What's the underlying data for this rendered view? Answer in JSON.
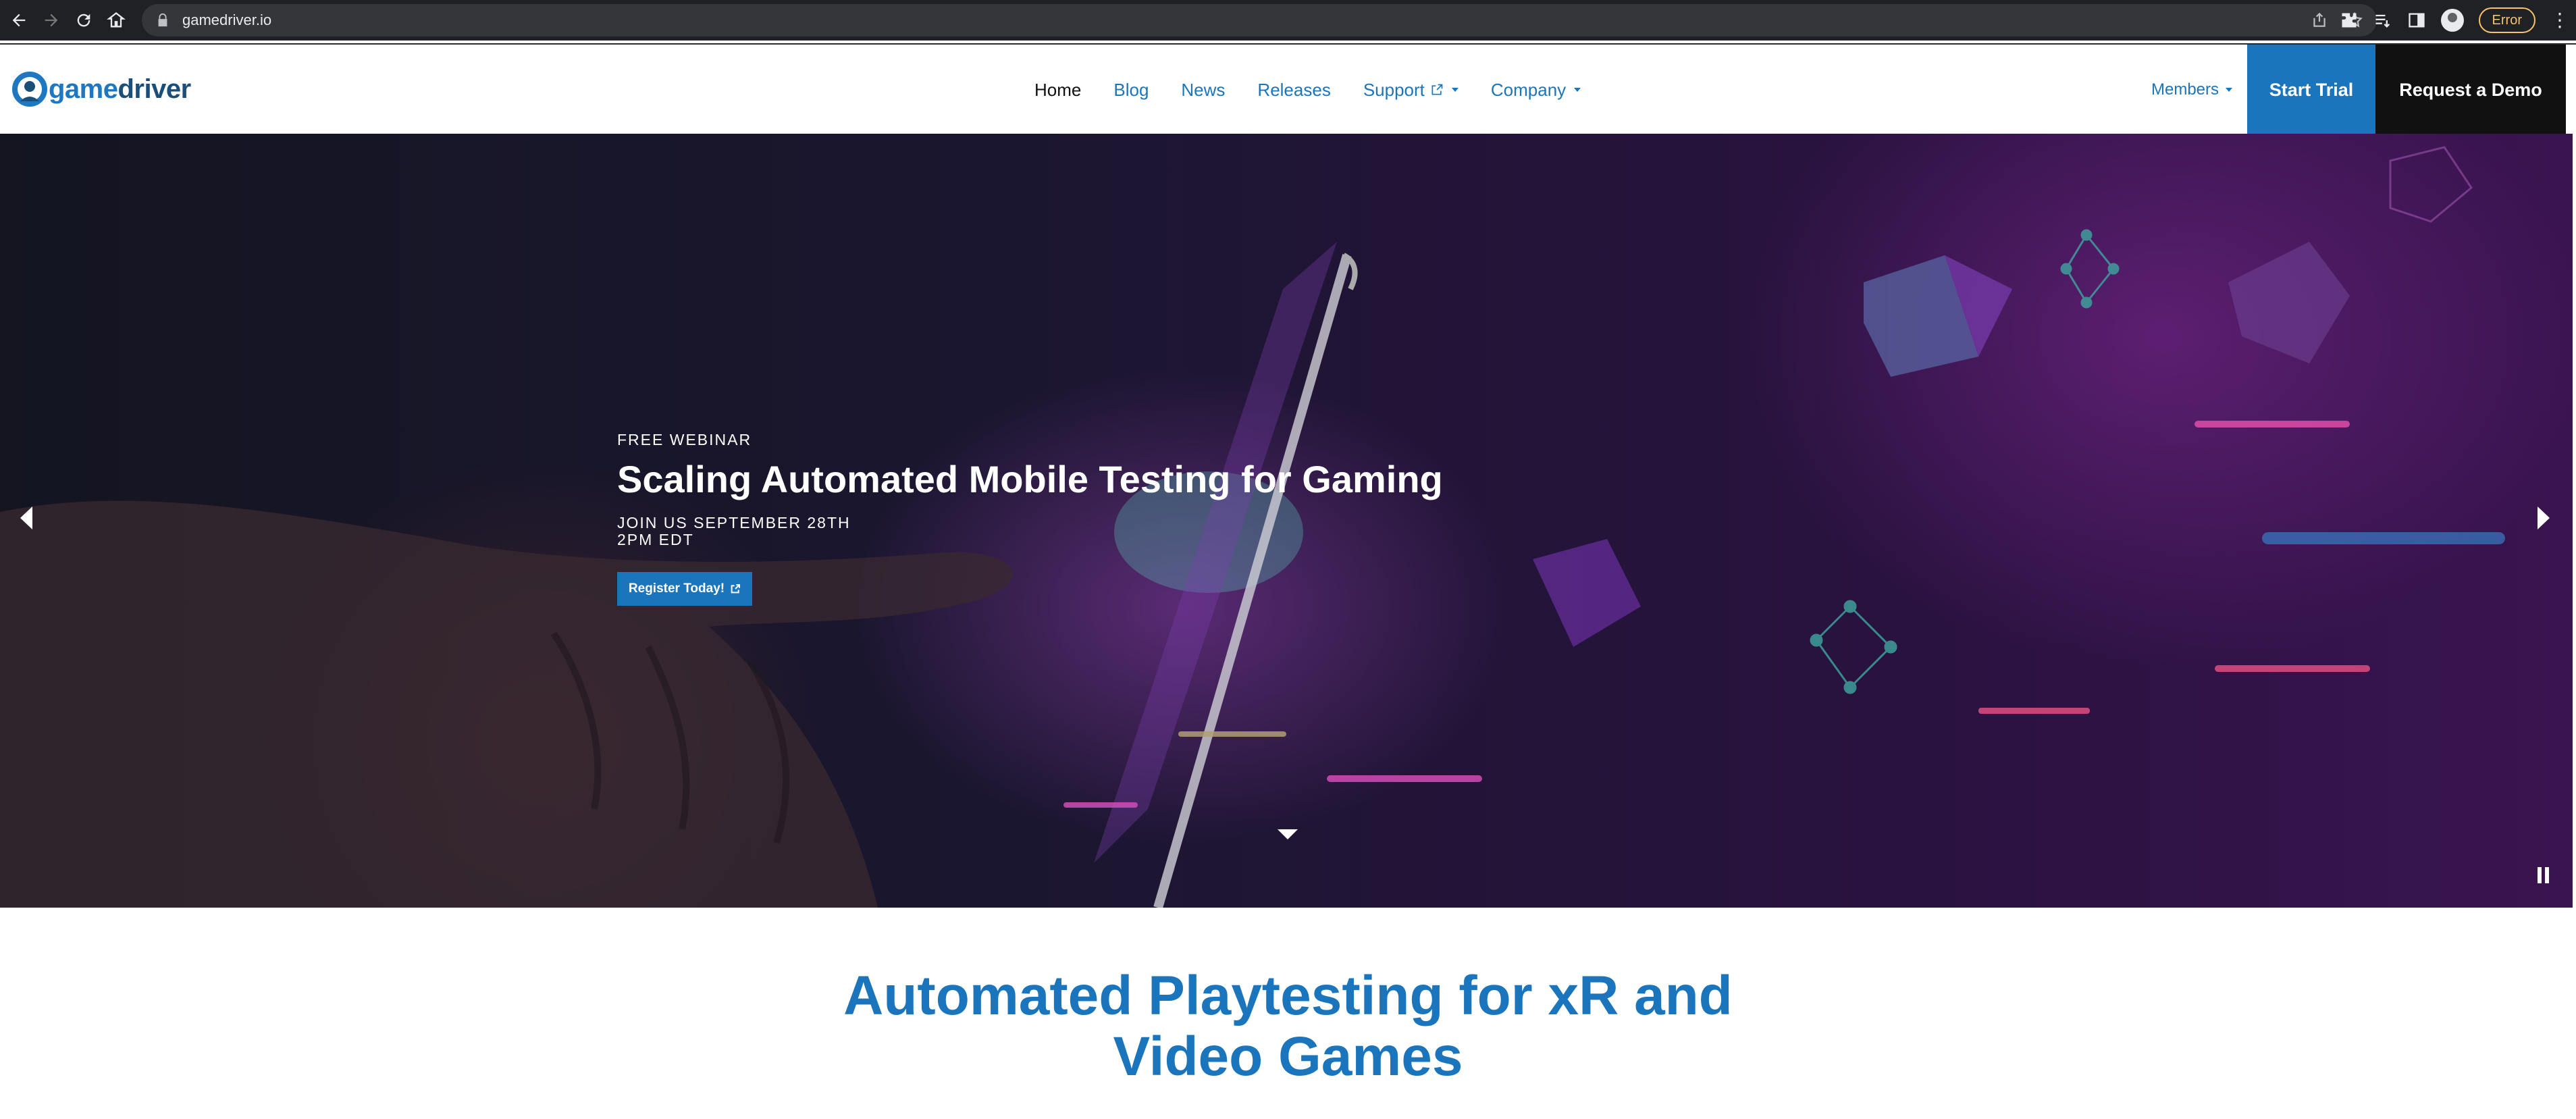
{
  "browser": {
    "url": "gamedriver.io",
    "error_label": "Error"
  },
  "header": {
    "logo": {
      "part1": "game",
      "part2": "driver"
    },
    "nav": [
      {
        "label": "Home",
        "active": true
      },
      {
        "label": "Blog"
      },
      {
        "label": "News"
      },
      {
        "label": "Releases"
      },
      {
        "label": "Support"
      },
      {
        "label": "Company"
      }
    ],
    "members_label": "Members",
    "start_trial_label": "Start Trial",
    "request_demo_label": "Request a Demo"
  },
  "hero": {
    "eyebrow": "FREE WEBINAR",
    "title": "Scaling Automated Mobile Testing for Gaming",
    "sub_line1": "JOIN US SEPTEMBER 28TH",
    "sub_line2": "2PM EDT",
    "cta_label": "Register Today!"
  },
  "section": {
    "title_line1": "Automated Playtesting for xR and",
    "title_line2": "Video Games"
  },
  "colors": {
    "brand_blue": "#1b75bc",
    "dark": "#111111"
  }
}
